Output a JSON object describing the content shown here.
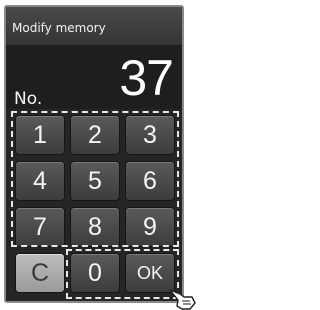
{
  "screen": {
    "title": "Modify memory"
  },
  "readout": {
    "label": "No.",
    "value": "37"
  },
  "keypad": {
    "k1": "1",
    "k2": "2",
    "k3": "3",
    "k4": "4",
    "k5": "5",
    "k6": "6",
    "k7": "7",
    "k8": "8",
    "k9": "9",
    "clear": "C",
    "k0": "0",
    "ok": "OK"
  },
  "icons": {
    "pointer": "hand-pointer-icon"
  }
}
